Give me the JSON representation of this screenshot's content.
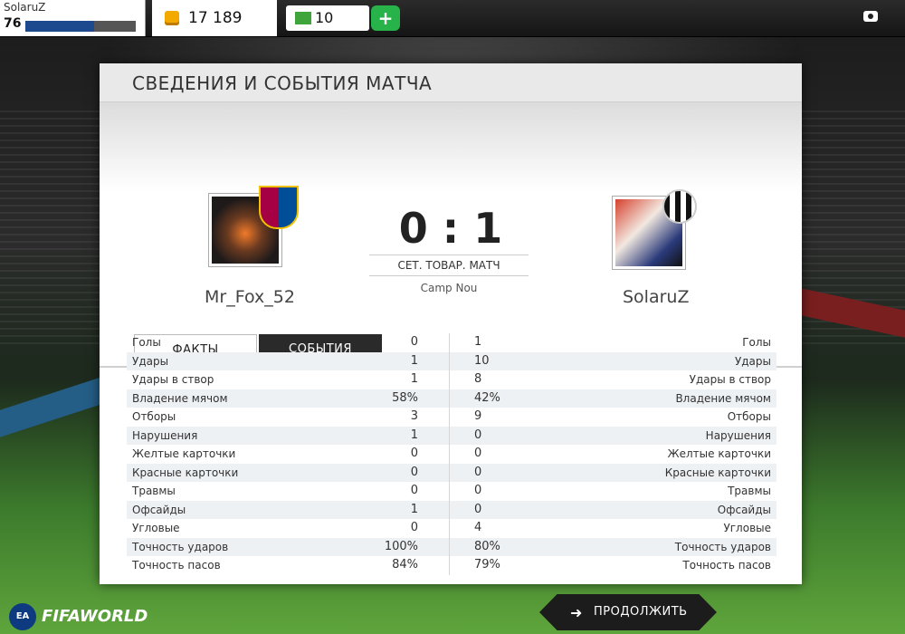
{
  "topbar": {
    "player_name": "SolaruZ",
    "player_level": "76",
    "xp_progress": 0.62,
    "coins": "17 189",
    "cash": "10"
  },
  "panel": {
    "title": "СВЕДЕНИЯ И СОБЫТИЯ МАТЧА",
    "home_team": "Mr_Fox_52",
    "away_team": "SolaruZ",
    "score": "0 : 1",
    "match_type": "СЕТ. ТОВАР. МАТЧ",
    "venue": "Camp Nou",
    "tabs": [
      "ФАКТЫ",
      "СОБЫТИЯ"
    ]
  },
  "stats": [
    {
      "label": "Голы",
      "home": "0",
      "away": "1"
    },
    {
      "label": "Удары",
      "home": "1",
      "away": "10"
    },
    {
      "label": "Удары в створ",
      "home": "1",
      "away": "8"
    },
    {
      "label": "Владение мячом",
      "home": "58%",
      "away": "42%"
    },
    {
      "label": "Отборы",
      "home": "3",
      "away": "9"
    },
    {
      "label": "Нарушения",
      "home": "1",
      "away": "0"
    },
    {
      "label": "Желтые карточки",
      "home": "0",
      "away": "0"
    },
    {
      "label": "Красные карточки",
      "home": "0",
      "away": "0"
    },
    {
      "label": "Травмы",
      "home": "0",
      "away": "0"
    },
    {
      "label": "Офсайды",
      "home": "1",
      "away": "0"
    },
    {
      "label": "Угловые",
      "home": "0",
      "away": "4"
    },
    {
      "label": "Точность ударов",
      "home": "100%",
      "away": "80%"
    },
    {
      "label": "Точность пасов",
      "home": "84%",
      "away": "79%"
    }
  ],
  "footer": {
    "brand": "FIFAWORLD",
    "ea_badge": "EA",
    "continue_label": "ПРОДОЛЖИТЬ"
  }
}
